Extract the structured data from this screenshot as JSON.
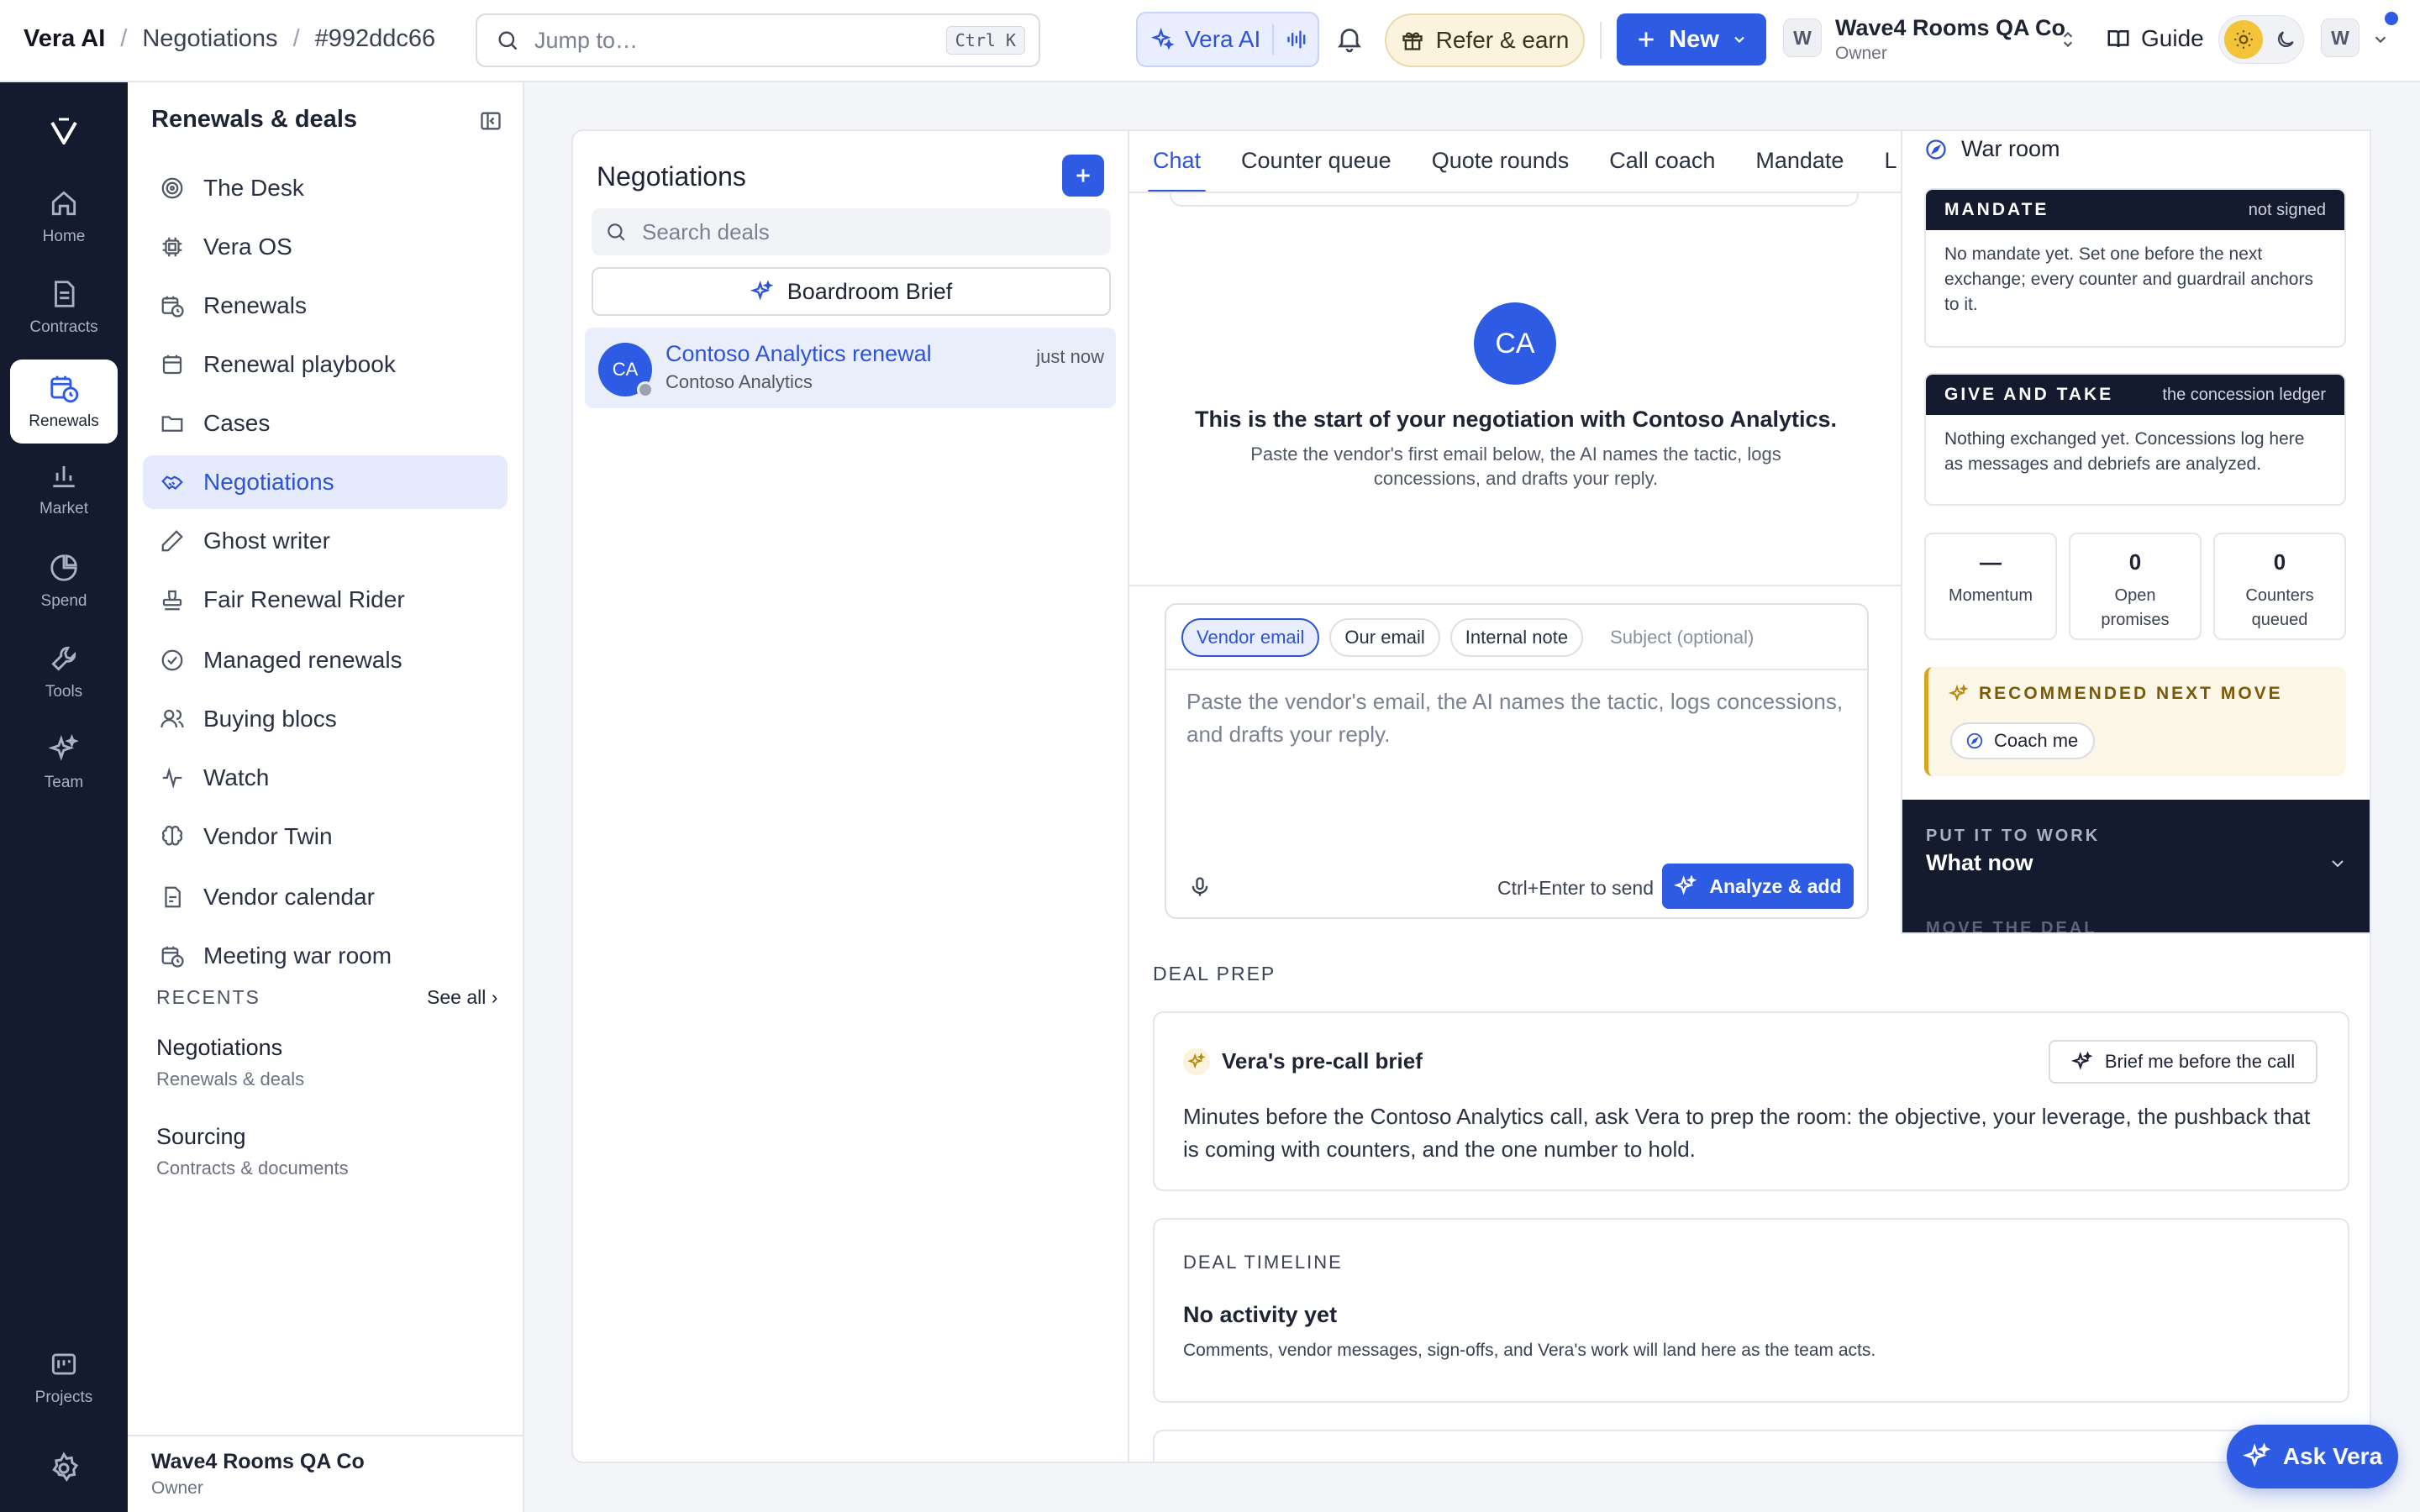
{
  "topbar": {
    "breadcrumb": [
      "Vera AI",
      "Negotiations",
      "#992ddc66"
    ],
    "search_placeholder": "Jump to…",
    "search_shortcut": "Ctrl K",
    "vera_ai_label": "Vera AI",
    "refer_label": "Refer & earn",
    "new_label": "New",
    "workspace_initial": "W",
    "workspace_name": "Wave4 Rooms QA Co",
    "workspace_role": "Owner",
    "guide_label": "Guide",
    "user_initial": "W",
    "accent": "#2d5be3"
  },
  "rail": {
    "items": [
      {
        "label": "Home",
        "icon": "home-icon"
      },
      {
        "label": "Contracts",
        "icon": "document-icon"
      },
      {
        "label": "Renewals",
        "icon": "calendar-clock-icon"
      },
      {
        "label": "Market",
        "icon": "bar-chart-icon"
      },
      {
        "label": "Spend",
        "icon": "pie-chart-icon"
      },
      {
        "label": "Tools",
        "icon": "wrench-icon"
      },
      {
        "label": "Team",
        "icon": "sparkles-icon"
      },
      {
        "label": "Projects",
        "icon": "projects-icon"
      }
    ],
    "active": "Renewals"
  },
  "sidebar": {
    "title": "Renewals & deals",
    "items": [
      {
        "label": "The Desk",
        "icon": "target-icon"
      },
      {
        "label": "Vera OS",
        "icon": "chip-icon"
      },
      {
        "label": "Renewals",
        "icon": "calendar-clock-icon"
      },
      {
        "label": "Renewal playbook",
        "icon": "calendar-icon"
      },
      {
        "label": "Cases",
        "icon": "folder-icon"
      },
      {
        "label": "Negotiations",
        "icon": "handshake-icon"
      },
      {
        "label": "Ghost writer",
        "icon": "pen-icon"
      },
      {
        "label": "Fair Renewal Rider",
        "icon": "stamp-icon"
      },
      {
        "label": "Managed renewals",
        "icon": "check-circle-icon"
      },
      {
        "label": "Buying blocs",
        "icon": "users-icon"
      },
      {
        "label": "Watch",
        "icon": "pulse-icon"
      },
      {
        "label": "Vendor Twin",
        "icon": "brain-icon"
      },
      {
        "label": "Vendor calendar",
        "icon": "calendar-doc-icon"
      },
      {
        "label": "Meeting war room",
        "icon": "calendar-clock-icon"
      }
    ],
    "active": "Negotiations",
    "recents_heading": "RECENTS",
    "see_all": "See all ›",
    "recents": [
      {
        "title": "Negotiations",
        "subtitle": "Renewals & deals"
      },
      {
        "title": "Sourcing",
        "subtitle": "Contracts & documents"
      }
    ],
    "footer_name": "Wave4 Rooms QA Co",
    "footer_role": "Owner"
  },
  "list": {
    "title": "Negotiations",
    "search_placeholder": "Search deals",
    "brief_label": "Boardroom Brief",
    "deals": [
      {
        "initials": "CA",
        "name": "Contoso Analytics renewal",
        "company": "Contoso Analytics",
        "time": "just now"
      }
    ]
  },
  "chat": {
    "tabs": [
      "Chat",
      "Counter queue",
      "Quote rounds",
      "Call coach",
      "Mandate",
      "L"
    ],
    "active_tab": "Chat",
    "avatar": "CA",
    "start_title": "This is the start of your negotiation with Contoso Analytics.",
    "start_sub": "Paste the vendor's first email below, the AI names the tactic, logs concessions, and drafts your reply.",
    "composer_tabs": [
      "Vendor email",
      "Our email",
      "Internal note"
    ],
    "composer_active": "Vendor email",
    "subject_placeholder": "Subject (optional)",
    "body_placeholder": "Paste the vendor's email, the AI names the tactic, logs concessions, and drafts your reply.",
    "send_hint": "Ctrl+Enter to send",
    "analyze_label": "Analyze & add"
  },
  "deal_prep": {
    "heading": "DEAL PREP",
    "brief_title": "Vera's pre-call brief",
    "brief_button": "Brief me before the call",
    "brief_text": "Minutes before the Contoso Analytics call, ask Vera to prep the room: the objective, your leverage, the pushback that is coming with counters, and the one number to hold.",
    "timeline_heading": "DEAL TIMELINE",
    "timeline_title": "No activity yet",
    "timeline_sub": "Comments, vendor messages, sign-offs, and Vera's work will land here as the team acts."
  },
  "war_room": {
    "title": "War room",
    "mandate_label": "MANDATE",
    "mandate_status": "not signed",
    "mandate_text": "No mandate yet. Set one before the next exchange; every counter and guardrail anchors to it.",
    "give_label": "GIVE AND TAKE",
    "give_status": "the concession ledger",
    "give_text": "Nothing exchanged yet. Concessions log here as messages and debriefs are analyzed.",
    "stats": [
      {
        "value": "—",
        "label": "Momentum"
      },
      {
        "value": "0",
        "label": "Open promises"
      },
      {
        "value": "0",
        "label": "Counters queued"
      }
    ],
    "rec_label": "RECOMMENDED NEXT MOVE",
    "coach_label": "Coach me",
    "ptw_eyebrow": "PUT IT TO WORK",
    "ptw_title": "What now",
    "move_label": "MOVE THE DEAL"
  },
  "ask_vera": "Ask Vera"
}
